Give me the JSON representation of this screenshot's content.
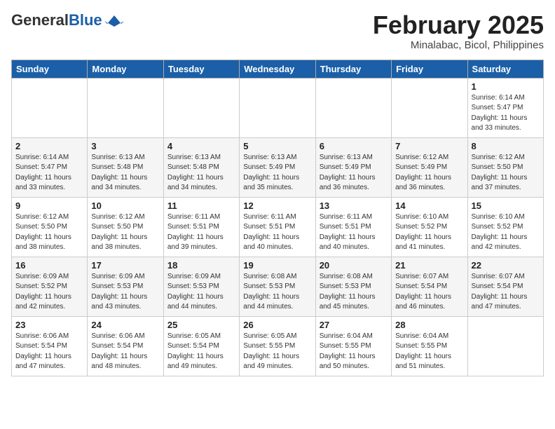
{
  "header": {
    "logo_general": "General",
    "logo_blue": "Blue",
    "month_title": "February 2025",
    "location": "Minalabac, Bicol, Philippines"
  },
  "days_of_week": [
    "Sunday",
    "Monday",
    "Tuesday",
    "Wednesday",
    "Thursday",
    "Friday",
    "Saturday"
  ],
  "weeks": [
    [
      {
        "day": "",
        "info": ""
      },
      {
        "day": "",
        "info": ""
      },
      {
        "day": "",
        "info": ""
      },
      {
        "day": "",
        "info": ""
      },
      {
        "day": "",
        "info": ""
      },
      {
        "day": "",
        "info": ""
      },
      {
        "day": "1",
        "info": "Sunrise: 6:14 AM\nSunset: 5:47 PM\nDaylight: 11 hours\nand 33 minutes."
      }
    ],
    [
      {
        "day": "2",
        "info": "Sunrise: 6:14 AM\nSunset: 5:47 PM\nDaylight: 11 hours\nand 33 minutes."
      },
      {
        "day": "3",
        "info": "Sunrise: 6:13 AM\nSunset: 5:48 PM\nDaylight: 11 hours\nand 34 minutes."
      },
      {
        "day": "4",
        "info": "Sunrise: 6:13 AM\nSunset: 5:48 PM\nDaylight: 11 hours\nand 34 minutes."
      },
      {
        "day": "5",
        "info": "Sunrise: 6:13 AM\nSunset: 5:49 PM\nDaylight: 11 hours\nand 35 minutes."
      },
      {
        "day": "6",
        "info": "Sunrise: 6:13 AM\nSunset: 5:49 PM\nDaylight: 11 hours\nand 36 minutes."
      },
      {
        "day": "7",
        "info": "Sunrise: 6:12 AM\nSunset: 5:49 PM\nDaylight: 11 hours\nand 36 minutes."
      },
      {
        "day": "8",
        "info": "Sunrise: 6:12 AM\nSunset: 5:50 PM\nDaylight: 11 hours\nand 37 minutes."
      }
    ],
    [
      {
        "day": "9",
        "info": "Sunrise: 6:12 AM\nSunset: 5:50 PM\nDaylight: 11 hours\nand 38 minutes."
      },
      {
        "day": "10",
        "info": "Sunrise: 6:12 AM\nSunset: 5:50 PM\nDaylight: 11 hours\nand 38 minutes."
      },
      {
        "day": "11",
        "info": "Sunrise: 6:11 AM\nSunset: 5:51 PM\nDaylight: 11 hours\nand 39 minutes."
      },
      {
        "day": "12",
        "info": "Sunrise: 6:11 AM\nSunset: 5:51 PM\nDaylight: 11 hours\nand 40 minutes."
      },
      {
        "day": "13",
        "info": "Sunrise: 6:11 AM\nSunset: 5:51 PM\nDaylight: 11 hours\nand 40 minutes."
      },
      {
        "day": "14",
        "info": "Sunrise: 6:10 AM\nSunset: 5:52 PM\nDaylight: 11 hours\nand 41 minutes."
      },
      {
        "day": "15",
        "info": "Sunrise: 6:10 AM\nSunset: 5:52 PM\nDaylight: 11 hours\nand 42 minutes."
      }
    ],
    [
      {
        "day": "16",
        "info": "Sunrise: 6:09 AM\nSunset: 5:52 PM\nDaylight: 11 hours\nand 42 minutes."
      },
      {
        "day": "17",
        "info": "Sunrise: 6:09 AM\nSunset: 5:53 PM\nDaylight: 11 hours\nand 43 minutes."
      },
      {
        "day": "18",
        "info": "Sunrise: 6:09 AM\nSunset: 5:53 PM\nDaylight: 11 hours\nand 44 minutes."
      },
      {
        "day": "19",
        "info": "Sunrise: 6:08 AM\nSunset: 5:53 PM\nDaylight: 11 hours\nand 44 minutes."
      },
      {
        "day": "20",
        "info": "Sunrise: 6:08 AM\nSunset: 5:53 PM\nDaylight: 11 hours\nand 45 minutes."
      },
      {
        "day": "21",
        "info": "Sunrise: 6:07 AM\nSunset: 5:54 PM\nDaylight: 11 hours\nand 46 minutes."
      },
      {
        "day": "22",
        "info": "Sunrise: 6:07 AM\nSunset: 5:54 PM\nDaylight: 11 hours\nand 47 minutes."
      }
    ],
    [
      {
        "day": "23",
        "info": "Sunrise: 6:06 AM\nSunset: 5:54 PM\nDaylight: 11 hours\nand 47 minutes."
      },
      {
        "day": "24",
        "info": "Sunrise: 6:06 AM\nSunset: 5:54 PM\nDaylight: 11 hours\nand 48 minutes."
      },
      {
        "day": "25",
        "info": "Sunrise: 6:05 AM\nSunset: 5:54 PM\nDaylight: 11 hours\nand 49 minutes."
      },
      {
        "day": "26",
        "info": "Sunrise: 6:05 AM\nSunset: 5:55 PM\nDaylight: 11 hours\nand 49 minutes."
      },
      {
        "day": "27",
        "info": "Sunrise: 6:04 AM\nSunset: 5:55 PM\nDaylight: 11 hours\nand 50 minutes."
      },
      {
        "day": "28",
        "info": "Sunrise: 6:04 AM\nSunset: 5:55 PM\nDaylight: 11 hours\nand 51 minutes."
      },
      {
        "day": "",
        "info": ""
      }
    ]
  ]
}
